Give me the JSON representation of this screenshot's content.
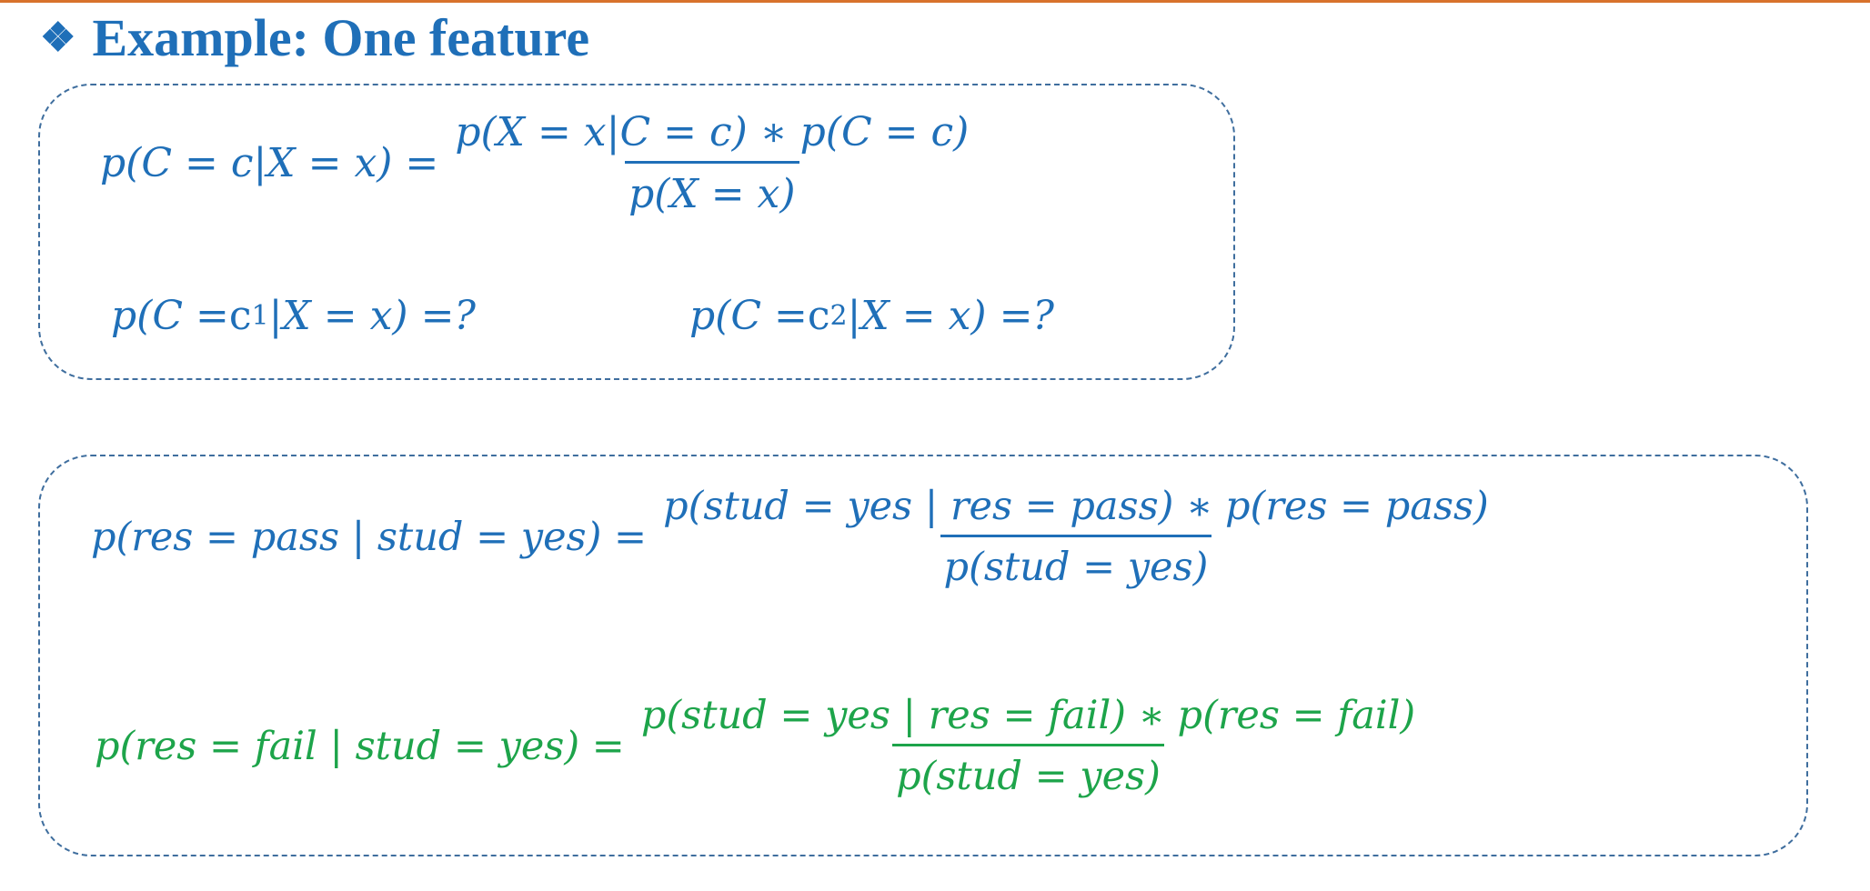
{
  "heading": {
    "bullet": "❖",
    "title": "Example: One feature"
  },
  "formulas": {
    "bayes": {
      "lhs": "p(C = c|X = x) =",
      "numerator": "p(X = x|C = c) ∗ p(C = c)",
      "denominator": "p(X = x)"
    },
    "question_c1": {
      "prefix": "p(C = ",
      "c": "c",
      "sub": "1",
      "suffix": "|X = x) =?"
    },
    "question_c2": {
      "prefix": "p(C = ",
      "c": "c",
      "sub": "2",
      "suffix": "|X = x) =?"
    },
    "pass": {
      "lhs": "p(res = pass | stud = yes) =",
      "numerator": "p(stud = yes | res = pass) ∗ p(res = pass)",
      "denominator": "p(stud = yes)"
    },
    "fail": {
      "lhs": "p(res = fail | stud = yes) =",
      "numerator": "p(stud = yes | res = fail) ∗ p(res = fail)",
      "denominator": "p(stud = yes)"
    }
  },
  "colors": {
    "blue": "#1f6fb8",
    "green": "#1da44a",
    "rule": "#d8722c",
    "border": "#3f6e9e"
  }
}
